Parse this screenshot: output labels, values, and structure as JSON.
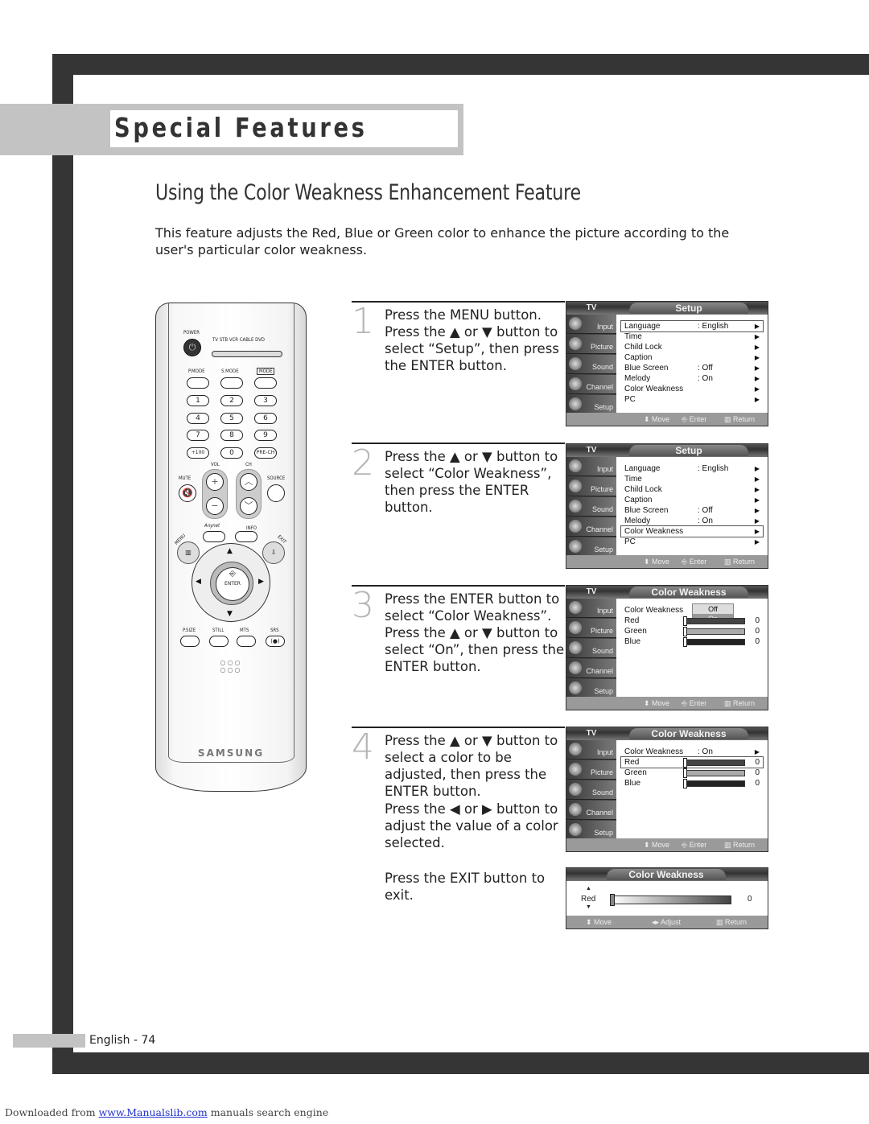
{
  "section": {
    "title": "Special Features"
  },
  "page": {
    "heading": "Using the Color Weakness Enhancement Feature",
    "intro": "This feature adjusts the Red, Blue or Green color to enhance the picture according to the user's particular color weakness."
  },
  "remote": {
    "power": "POWER",
    "sources": "TV  STB  VCR  CABLE  DVD",
    "pmode": "P.MODE",
    "smode": "S.MODE",
    "mode": "MODE",
    "keys": [
      "1",
      "2",
      "3",
      "4",
      "5",
      "6",
      "7",
      "8",
      "9",
      "+100",
      "0",
      "PRE-CH"
    ],
    "vol": "VOL",
    "ch": "CH",
    "mute": "MUTE",
    "source": "SOURCE",
    "anynet": "Anynet",
    "info": "INFO",
    "menu": "MENU",
    "exit": "EXIT",
    "enter": "ENTER",
    "psize": "P.SIZE",
    "still": "STILL",
    "mts": "MTS",
    "srs": "SRS",
    "brand": "SAMSUNG"
  },
  "steps": [
    {
      "number": "1",
      "text": "Press the MENU button. Press the ▲ or ▼ button to select “Setup”, then press the ENTER button."
    },
    {
      "number": "2",
      "text": "Press the ▲ or ▼ button to select “Color Weakness”, then press the ENTER button."
    },
    {
      "number": "3",
      "text": "Press the ENTER button to select “Color Weakness”. Press the ▲ or ▼ button to select “On”, then press the ENTER button."
    },
    {
      "number": "4",
      "text": "Press the ▲ or ▼ button to select a color to be adjusted, then press the ENTER button.",
      "text2": "Press the ◀ or ▶ button to adjust the value of a color selected.",
      "text3": "Press the EXIT button to exit."
    }
  ],
  "osd": {
    "tv_label": "TV",
    "sidebar": [
      "Input",
      "Picture",
      "Sound",
      "Channel",
      "Setup"
    ],
    "hints": {
      "move": "Move",
      "enter": "Enter",
      "return": "Return",
      "adjust": "Adjust"
    },
    "setup_title": "Setup",
    "setup_items": [
      {
        "label": "Language",
        "value": ": English"
      },
      {
        "label": "Time",
        "value": ""
      },
      {
        "label": "Child Lock",
        "value": ""
      },
      {
        "label": "Caption",
        "value": ""
      },
      {
        "label": "Blue Screen",
        "value": ": Off"
      },
      {
        "label": "Melody",
        "value": ": On"
      },
      {
        "label": "Color Weakness",
        "value": ""
      },
      {
        "label": "PC",
        "value": ""
      }
    ],
    "cw_title": "Color Weakness",
    "cw_label": "Color Weakness",
    "cw_state": ": On",
    "cw_options": [
      "Off",
      "On"
    ],
    "colors": [
      {
        "label": "Red",
        "value": "0"
      },
      {
        "label": "Green",
        "value": "0"
      },
      {
        "label": "Blue",
        "value": "0"
      }
    ],
    "adjust": {
      "label": "Red",
      "value": "0"
    }
  },
  "footer": {
    "page": "English - 74",
    "download_prefix": "Downloaded from ",
    "download_link": "www.Manualslib.com",
    "download_suffix": " manuals search engine"
  }
}
